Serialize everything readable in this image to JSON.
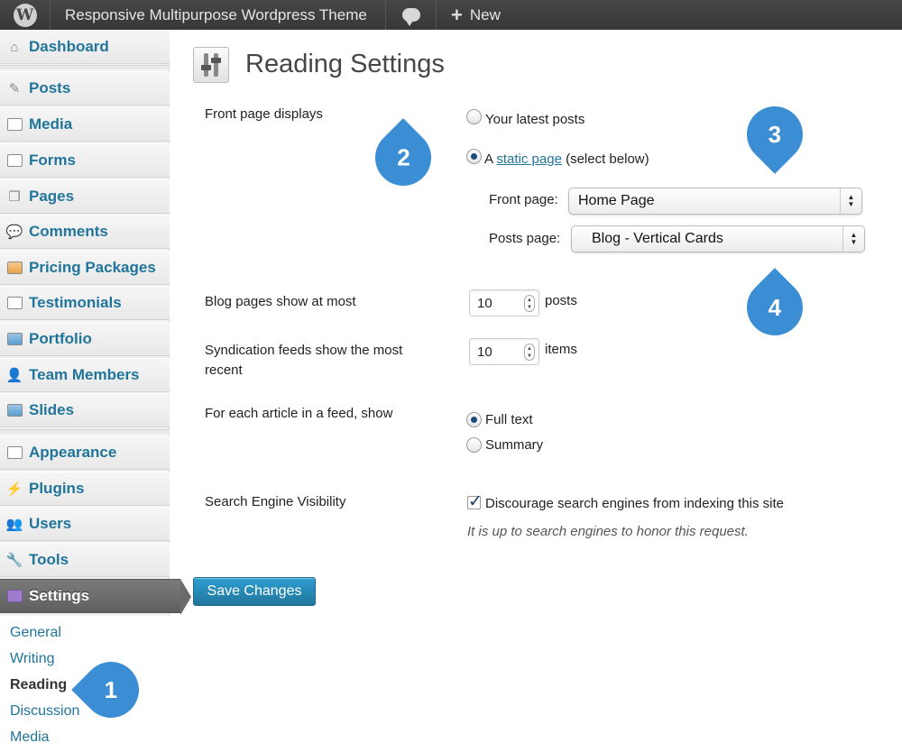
{
  "adminbar": {
    "logo_text": "W",
    "site_title": "Responsive Multipurpose Wordpress Theme",
    "new_label": "New"
  },
  "sidebar": {
    "items": [
      {
        "label": "Dashboard",
        "icon": "home-icon"
      },
      {
        "label": "Posts",
        "icon": "pushpin-icon"
      },
      {
        "label": "Media",
        "icon": "media-icon"
      },
      {
        "label": "Forms",
        "icon": "forms-icon"
      },
      {
        "label": "Pages",
        "icon": "pages-icon"
      },
      {
        "label": "Comments",
        "icon": "comment-icon"
      },
      {
        "label": "Pricing Packages",
        "icon": "pricing-icon"
      },
      {
        "label": "Testimonials",
        "icon": "testimonials-icon"
      },
      {
        "label": "Portfolio",
        "icon": "portfolio-icon"
      },
      {
        "label": "Team Members",
        "icon": "team-icon"
      },
      {
        "label": "Slides",
        "icon": "slides-icon"
      },
      {
        "label": "Appearance",
        "icon": "appearance-icon"
      },
      {
        "label": "Plugins",
        "icon": "plugin-icon"
      },
      {
        "label": "Users",
        "icon": "users-icon"
      },
      {
        "label": "Tools",
        "icon": "tools-icon"
      },
      {
        "label": "Settings",
        "icon": "settings-icon"
      }
    ],
    "submenu": [
      "General",
      "Writing",
      "Reading",
      "Discussion",
      "Media"
    ]
  },
  "page": {
    "title": "Reading Settings",
    "front_page_displays": {
      "label": "Front page displays",
      "option_latest": "Your latest posts",
      "option_static_prefix": "A ",
      "option_static_link": "static page",
      "option_static_suffix": " (select below)",
      "selected": "static"
    },
    "front_page_select": {
      "label": "Front page:",
      "value": "Home Page"
    },
    "posts_page_select": {
      "label": "Posts page:",
      "value": "Blog - Vertical Cards"
    },
    "blog_pages": {
      "label": "Blog pages show at most",
      "value": "10",
      "unit": "posts"
    },
    "syndication": {
      "label_line1": "Syndication feeds show the most",
      "label_line2": "recent",
      "value": "10",
      "unit": "items"
    },
    "feed_article": {
      "label": "For each article in a feed, show",
      "option_full": "Full text",
      "option_summary": "Summary",
      "selected": "full"
    },
    "search_visibility": {
      "label": "Search Engine Visibility",
      "checkbox_label": "Discourage search engines from indexing this site",
      "checked": true,
      "hint": "It is up to search engines to honor this request."
    },
    "save_button": "Save Changes"
  },
  "callouts": [
    "1",
    "2",
    "3",
    "4"
  ],
  "colors": {
    "accent": "#21759b",
    "callout": "#3b8ed3",
    "adminbar": "#464646"
  }
}
